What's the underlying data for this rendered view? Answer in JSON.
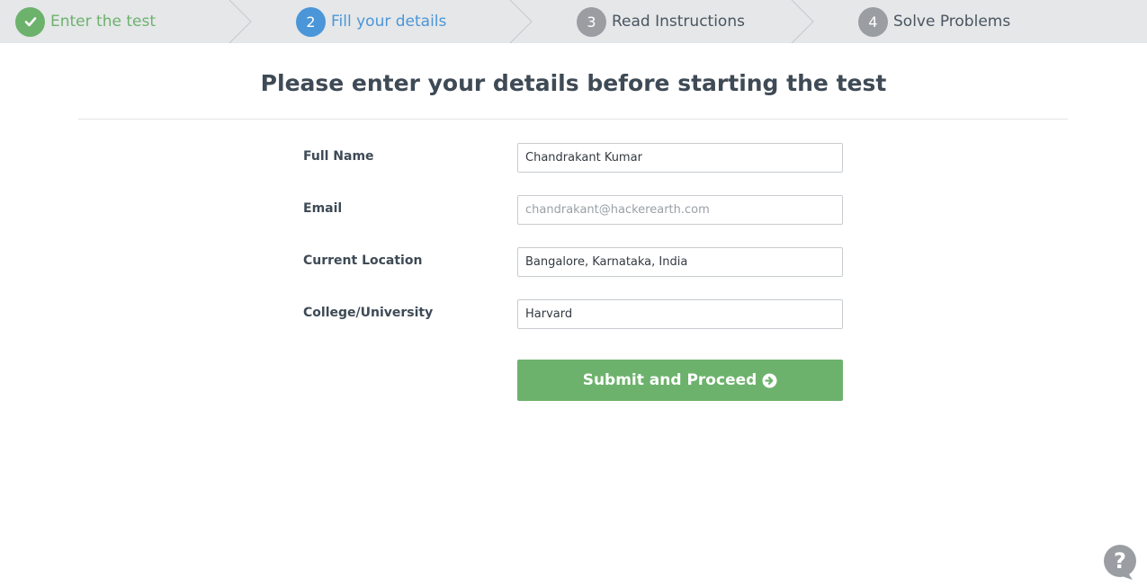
{
  "stepper": {
    "steps": [
      {
        "number": "",
        "label": "Enter the test",
        "state": "done",
        "icon": "check-icon"
      },
      {
        "number": "2",
        "label": "Fill your details",
        "state": "active"
      },
      {
        "number": "3",
        "label": "Read Instructions",
        "state": "todo"
      },
      {
        "number": "4",
        "label": "Solve Problems",
        "state": "todo"
      }
    ]
  },
  "main": {
    "title": "Please enter your details before starting the test",
    "fields": [
      {
        "label": "Full Name",
        "value": "Chandrakant Kumar",
        "placeholder": ""
      },
      {
        "label": "Email",
        "value": "",
        "placeholder": "chandrakant@hackerearth.com"
      },
      {
        "label": "Current Location",
        "value": "Bangalore, Karnataka, India",
        "placeholder": ""
      },
      {
        "label": "College/University",
        "value": "Harvard",
        "placeholder": ""
      }
    ],
    "submit_label": "Submit and Proceed",
    "submit_icon": "arrow-circle-right-icon"
  },
  "help": {
    "icon": "question-bubble-icon"
  },
  "colors": {
    "done": "#6db26c",
    "active": "#4a96d8",
    "todo": "#9a9ea3",
    "stepper_bg": "#e5e7e9",
    "button": "#6db26c"
  }
}
